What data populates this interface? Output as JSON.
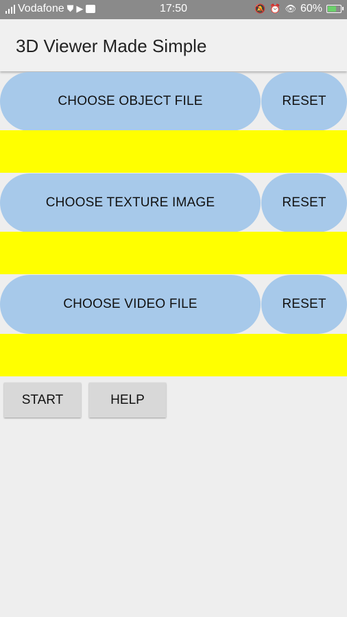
{
  "status_bar": {
    "carrier": "Vodafone",
    "time": "17:50",
    "battery": "60%"
  },
  "app_bar": {
    "title": "3D Viewer Made Simple"
  },
  "rows": [
    {
      "choose_label": "CHOOSE OBJECT FILE",
      "reset_label": "RESET"
    },
    {
      "choose_label": "CHOOSE TEXTURE IMAGE",
      "reset_label": "RESET"
    },
    {
      "choose_label": "CHOOSE VIDEO FILE",
      "reset_label": "RESET"
    }
  ],
  "actions": {
    "start_label": "START",
    "help_label": "HELP"
  },
  "colors": {
    "pill": "#a7c9ea",
    "yellow_field": "#ffff00",
    "status_bar": "#8a8a8a"
  }
}
